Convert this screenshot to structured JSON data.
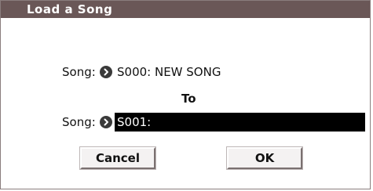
{
  "dialog": {
    "title": "Load a Song"
  },
  "source": {
    "label": "Song:",
    "value": "S000: NEW SONG"
  },
  "to_label": "To",
  "destination": {
    "label": "Song:",
    "value": "S001:"
  },
  "buttons": {
    "cancel_label": "Cancel",
    "ok_label": "OK"
  },
  "icons": {
    "source_select": "chevron-right-circle-icon",
    "destination_select": "chevron-right-circle-icon"
  },
  "colors": {
    "titlebar": "#6a5757",
    "field_bg": "#000000",
    "field_text": "#ffffff"
  }
}
